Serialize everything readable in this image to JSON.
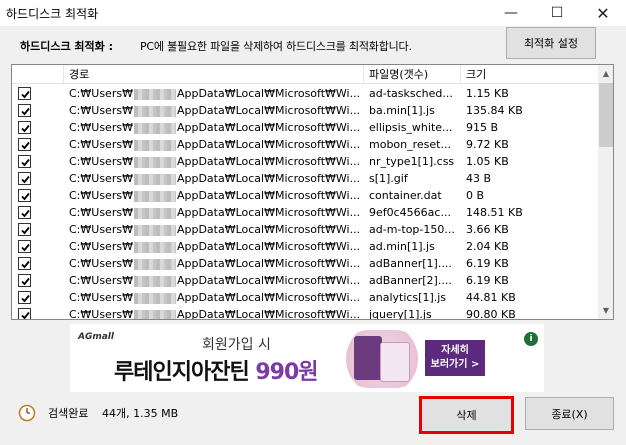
{
  "window": {
    "title": "하드디스크 최적화",
    "minimize_glyph": "—",
    "maximize_glyph": "☐",
    "close_glyph": "✕"
  },
  "header": {
    "label": "하드디스크 최적화 :",
    "description": "PC에 불필요한 파일을 삭제하여 하드디스크를 최적화합니다.",
    "settings_button": "최적화 설정"
  },
  "list": {
    "columns": [
      "",
      "경로",
      "파일명(갯수)",
      "크기"
    ],
    "rows": [
      {
        "checked": true,
        "path_prefix": "C:₩Users₩",
        "path_suffix": "AppData₩Local₩Microsoft₩Wi...",
        "name": "ad-tasksched...",
        "size": "1.15 KB"
      },
      {
        "checked": true,
        "path_prefix": "C:₩Users₩",
        "path_suffix": "AppData₩Local₩Microsoft₩Wi...",
        "name": "ba.min[1].js",
        "size": "135.84 KB"
      },
      {
        "checked": true,
        "path_prefix": "C:₩Users₩",
        "path_suffix": "AppData₩Local₩Microsoft₩Wi...",
        "name": "ellipsis_white...",
        "size": "915 B"
      },
      {
        "checked": true,
        "path_prefix": "C:₩Users₩",
        "path_suffix": "AppData₩Local₩Microsoft₩Wi...",
        "name": "mobon_reset...",
        "size": "9.72 KB"
      },
      {
        "checked": true,
        "path_prefix": "C:₩Users₩",
        "path_suffix": "AppData₩Local₩Microsoft₩Wi...",
        "name": "nr_type1[1].css",
        "size": "1.05 KB"
      },
      {
        "checked": true,
        "path_prefix": "C:₩Users₩",
        "path_suffix": "AppData₩Local₩Microsoft₩Wi...",
        "name": "s[1].gif",
        "size": "43 B"
      },
      {
        "checked": true,
        "path_prefix": "C:₩Users₩",
        "path_suffix": "AppData₩Local₩Microsoft₩Wi...",
        "name": "container.dat",
        "size": "0 B"
      },
      {
        "checked": true,
        "path_prefix": "C:₩Users₩",
        "path_suffix": "AppData₩Local₩Microsoft₩Wi...",
        "name": "9ef0c4566ac...",
        "size": "148.51 KB"
      },
      {
        "checked": true,
        "path_prefix": "C:₩Users₩",
        "path_suffix": "AppData₩Local₩Microsoft₩Wi...",
        "name": "ad-m-top-150...",
        "size": "3.66 KB"
      },
      {
        "checked": true,
        "path_prefix": "C:₩Users₩",
        "path_suffix": "AppData₩Local₩Microsoft₩Wi...",
        "name": "ad.min[1].js",
        "size": "2.04 KB"
      },
      {
        "checked": true,
        "path_prefix": "C:₩Users₩",
        "path_suffix": "AppData₩Local₩Microsoft₩Wi...",
        "name": "adBanner[1]....",
        "size": "6.19 KB"
      },
      {
        "checked": true,
        "path_prefix": "C:₩Users₩",
        "path_suffix": "AppData₩Local₩Microsoft₩Wi...",
        "name": "adBanner[2]....",
        "size": "6.19 KB"
      },
      {
        "checked": true,
        "path_prefix": "C:₩Users₩",
        "path_suffix": "AppData₩Local₩Microsoft₩Wi...",
        "name": "analytics[1].js",
        "size": "44.81 KB"
      },
      {
        "checked": true,
        "path_prefix": "C:₩Users₩",
        "path_suffix": "AppData₩Local₩Microsoft₩Wi...",
        "name": "jquery[1].js",
        "size": "90.80 KB"
      }
    ]
  },
  "ad": {
    "brand": "AGmall",
    "subtitle": "회원가입 시",
    "headline": "루테인지아잔틴 ",
    "price": "990원",
    "cta_line1": "자세히",
    "cta_line2": "보러가기 >",
    "info": "i"
  },
  "status": {
    "text": "검색완료",
    "summary": "44개, 1.35 MB"
  },
  "buttons": {
    "delete": "삭제",
    "close": "종료(X)"
  },
  "colors": {
    "highlight_border": "#e60000",
    "ad_accent": "#7b3aa8"
  }
}
